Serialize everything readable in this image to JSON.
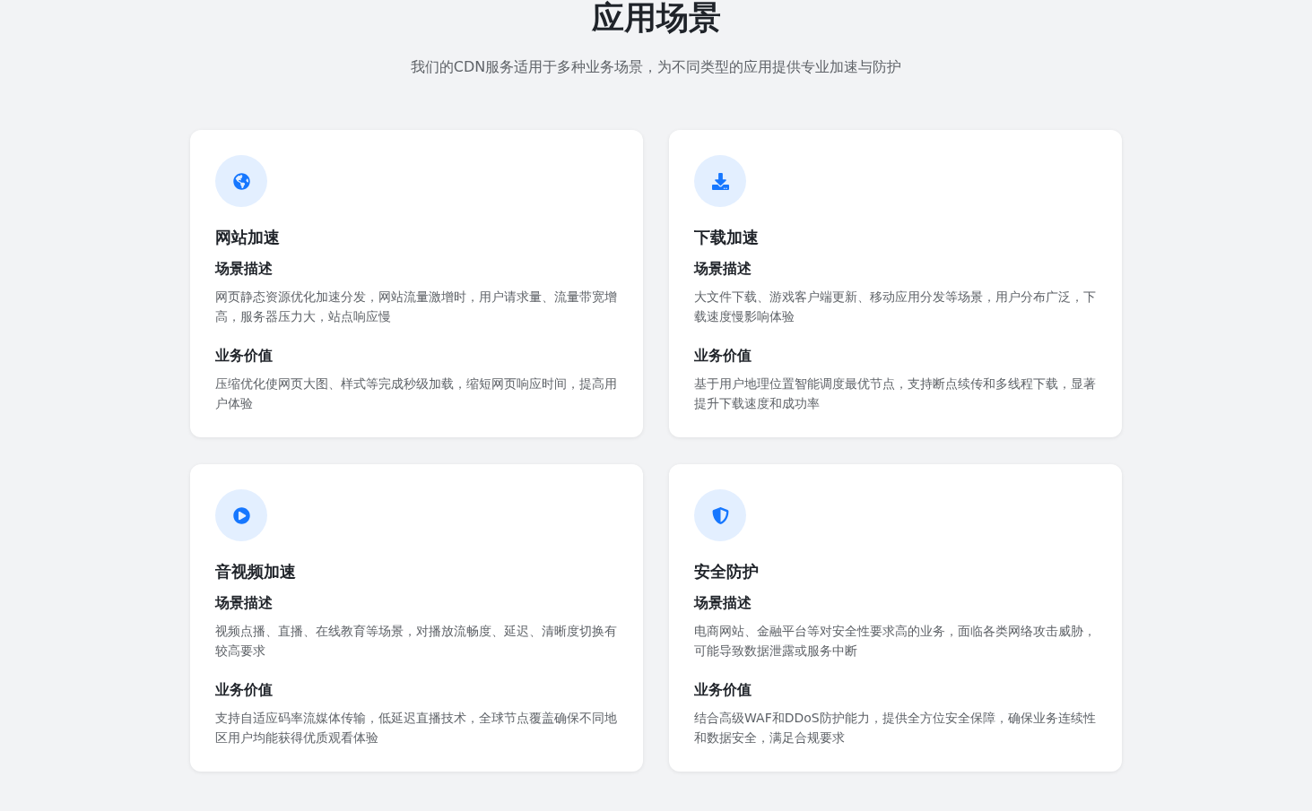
{
  "header": {
    "title": "应用场景",
    "subtitle": "我们的CDN服务适用于多种业务场景，为不同类型的应用提供专业加速与防护"
  },
  "cards": [
    {
      "kind": "globe",
      "title": "网站加速",
      "sections": [
        {
          "heading": "场景描述",
          "text": "网页静态资源优化加速分发，网站流量激增时，用户请求量、流量带宽增高，服务器压力大，站点响应慢"
        },
        {
          "heading": "业务价值",
          "text": "压缩优化使网页大图、样式等完成秒级加载，缩短网页响应时间，提高用户体验"
        }
      ]
    },
    {
      "kind": "download",
      "title": "下载加速",
      "sections": [
        {
          "heading": "场景描述",
          "text": "大文件下载、游戏客户端更新、移动应用分发等场景，用户分布广泛，下载速度慢影响体验"
        },
        {
          "heading": "业务价值",
          "text": "基于用户地理位置智能调度最优节点，支持断点续传和多线程下载，显著提升下载速度和成功率"
        }
      ]
    },
    {
      "kind": "play",
      "title": "音视频加速",
      "sections": [
        {
          "heading": "场景描述",
          "text": "视频点播、直播、在线教育等场景，对播放流畅度、延迟、清晰度切换有较高要求"
        },
        {
          "heading": "业务价值",
          "text": "支持自适应码率流媒体传输，低延迟直播技术，全球节点覆盖确保不同地区用户均能获得优质观看体验"
        }
      ]
    },
    {
      "kind": "shield",
      "title": "安全防护",
      "sections": [
        {
          "heading": "场景描述",
          "text": "电商网站、金融平台等对安全性要求高的业务，面临各类网络攻击威胁，可能导致数据泄露或服务中断"
        },
        {
          "heading": "业务价值",
          "text": "结合高级WAF和DDoS防护能力，提供全方位安全保障，确保业务连续性和数据安全，满足合规要求"
        }
      ]
    }
  ]
}
